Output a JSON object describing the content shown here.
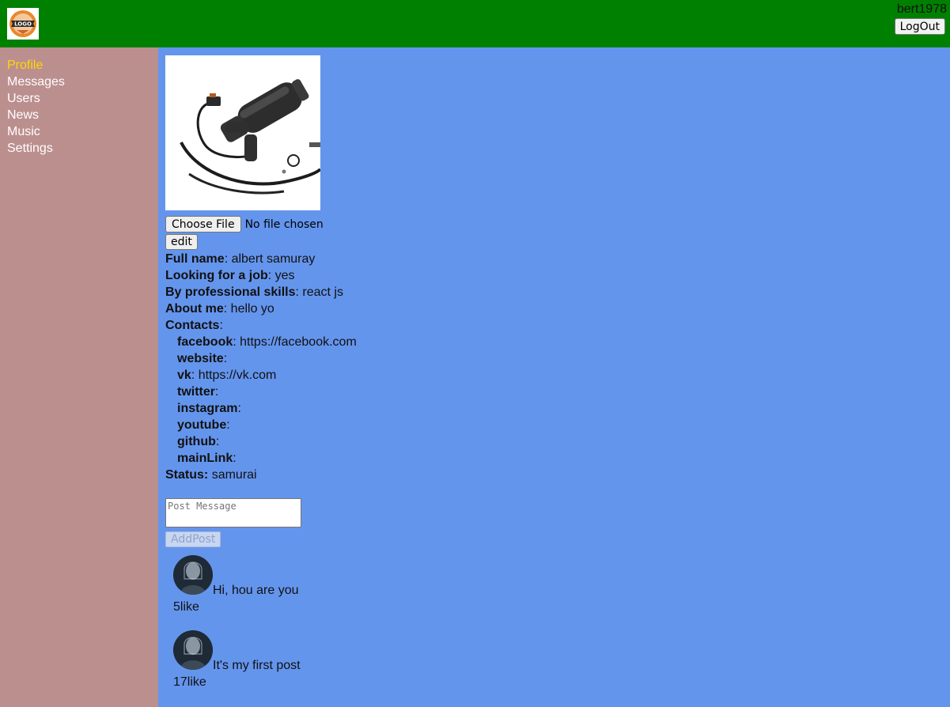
{
  "header": {
    "logo_text": "LOGO",
    "username": "bert1978",
    "logout_label": "LogOut"
  },
  "colors": {
    "header_bg": "#008000",
    "sidebar_bg": "#bc8f8f",
    "content_bg": "#6495ed",
    "active_nav": "#ffd700"
  },
  "sidebar": {
    "items": [
      {
        "label": "Profile",
        "active": true
      },
      {
        "label": "Messages",
        "active": false
      },
      {
        "label": "Users",
        "active": false
      },
      {
        "label": "News",
        "active": false
      },
      {
        "label": "Music",
        "active": false
      },
      {
        "label": "Settings",
        "active": false
      }
    ]
  },
  "profile": {
    "choose_file_label": "Choose File",
    "file_status": "No file chosen",
    "edit_label": "edit",
    "full_name_label": "Full name",
    "full_name": "albert samuray",
    "job_label": "Looking for a job",
    "job": "yes",
    "skills_label": "By professional skills",
    "skills": "react js",
    "about_label": "About me",
    "about": "hello yo",
    "contacts_label": "Contacts",
    "contacts": [
      {
        "name": "facebook",
        "value": "https://facebook.com"
      },
      {
        "name": "website",
        "value": ""
      },
      {
        "name": "vk",
        "value": "https://vk.com"
      },
      {
        "name": "twitter",
        "value": ""
      },
      {
        "name": "instagram",
        "value": ""
      },
      {
        "name": "youtube",
        "value": ""
      },
      {
        "name": "github",
        "value": ""
      },
      {
        "name": "mainLink",
        "value": ""
      }
    ],
    "status_label": "Status:",
    "status": "samurai"
  },
  "posts_form": {
    "placeholder": "Post Message",
    "add_label": "AddPost"
  },
  "posts": [
    {
      "text": "Hi, hou are you",
      "likes": "5",
      "likes_suffix": "like"
    },
    {
      "text": "It's my first post",
      "likes": "17",
      "likes_suffix": "like"
    }
  ]
}
